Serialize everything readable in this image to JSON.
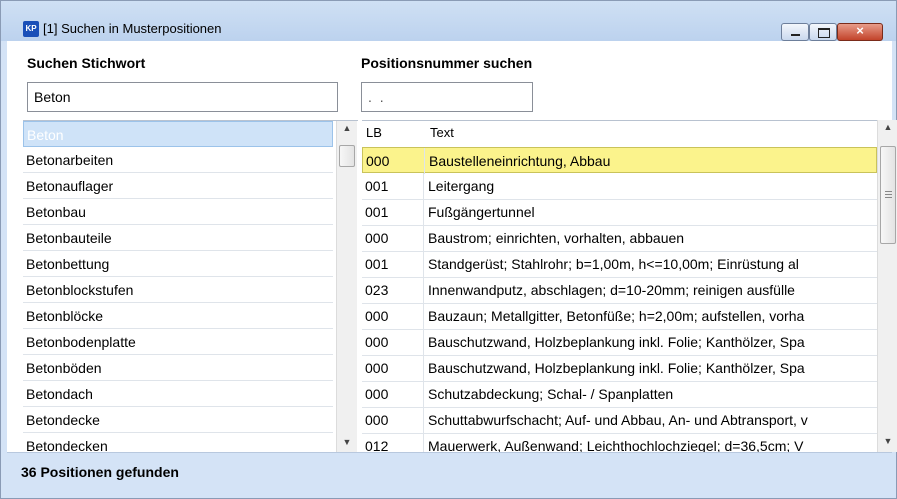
{
  "window": {
    "app_icon": "KP",
    "title": "[1] Suchen in Musterpositionen",
    "close_glyph": "×"
  },
  "search": {
    "keyword_label": "Suchen Stichwort",
    "keyword_value": "Beton",
    "position_label": "Positionsnummer suchen",
    "position_value": ". ."
  },
  "keyword_list": [
    "Beton",
    "Betonarbeiten",
    "Betonauflager",
    "Betonbau",
    "Betonbauteile",
    "Betonbettung",
    "Betonblockstufen",
    "Betonblöcke",
    "Betonbodenplatte",
    "Betonböden",
    "Betondach",
    "Betondecke",
    "Betondecken"
  ],
  "table": {
    "headers": {
      "lb": "LB",
      "text": "Text"
    },
    "rows": [
      {
        "lb": "000",
        "text": "Baustelleneinrichtung, Abbau"
      },
      {
        "lb": "001",
        "text": "Leitergang"
      },
      {
        "lb": "001",
        "text": "Fußgängertunnel"
      },
      {
        "lb": "000",
        "text": "Baustrom; einrichten, vorhalten, abbauen"
      },
      {
        "lb": "001",
        "text": "Standgerüst; Stahlrohr; b=1,00m, h<=10,00m; Einrüstung al"
      },
      {
        "lb": "023",
        "text": "Innenwandputz, abschlagen; d=10-20mm; reinigen ausfülle"
      },
      {
        "lb": "000",
        "text": "Bauzaun; Metallgitter, Betonfüße; h=2,00m; aufstellen, vorha"
      },
      {
        "lb": "000",
        "text": "Bauschutzwand, Holzbeplankung inkl. Folie; Kanthölzer, Spa"
      },
      {
        "lb": "000",
        "text": "Bauschutzwand, Holzbeplankung inkl. Folie; Kanthölzer, Spa"
      },
      {
        "lb": "000",
        "text": "Schutzabdeckung; Schal- / Spanplatten"
      },
      {
        "lb": "000",
        "text": "Schuttabwurfschacht; Auf- und Abbau, An- und Abtransport, v"
      },
      {
        "lb": "012",
        "text": "Mauerwerk, Außenwand; Leichthochlochziegel; d=36,5cm; V"
      }
    ]
  },
  "status": {
    "text": "36 Positionen gefunden"
  },
  "icons": {
    "minimize": "minimize-icon",
    "maximize": "maximize-icon",
    "close": "close-icon",
    "scroll_up": "scroll-up-icon",
    "scroll_down": "scroll-down-icon"
  },
  "colors": {
    "title_bar": "#c5d9f1",
    "close_button": "#c9452c",
    "selected_row": "#fbf38c",
    "selected_keyword": "#cfe3f8"
  }
}
